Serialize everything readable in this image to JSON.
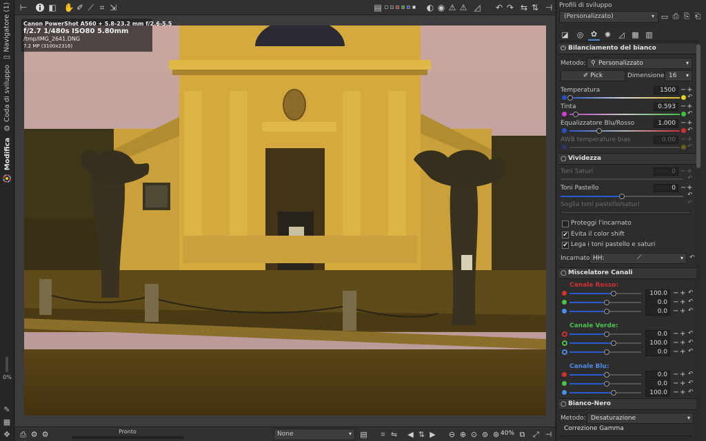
{
  "left_tabs": {
    "navigator": "Navigatore (1)",
    "queue": "Coda di sviluppo",
    "edit": "Modifica",
    "zoom_percent": "0%"
  },
  "image": {
    "exif_line1": "Canon PowerShot A560 + 5.8-23.2 mm f/2.6-5.5",
    "exif_line2": "f/2.7 1/480s ISO80 5.80mm",
    "exif_line3": "/tmp/IMG_2641.DNG",
    "exif_line4": "7.2 MP (3100x2316)"
  },
  "bottom": {
    "status": "Pronto",
    "preview_mode": "None",
    "zoom": "40%"
  },
  "right": {
    "profiles_title": "Profili di sviluppo",
    "profile_selected": "(Personalizzato)",
    "wb": {
      "title": "Bilanciamento del bianco",
      "method_label": "Metodo:",
      "method_value": "Personalizzato",
      "pick_label": "Pick",
      "size_label": "Dimensione:",
      "size_value": "16",
      "temp_label": "Temperatura",
      "temp_value": "1500",
      "tint_label": "Tinta",
      "tint_value": "0.593",
      "eq_label": "Equalizzatore Blu/Rosso",
      "eq_value": "1.000",
      "awb_label": "AWB temperature bias",
      "awb_value": "0.00"
    },
    "vibrance": {
      "title": "Vividezza",
      "saturated_label": "Toni Saturi",
      "saturated_value": "0",
      "pastel_label": "Toni Pastello",
      "pastel_value": "0",
      "threshold_label": "Soglia toni pastello/saturi",
      "protect_skin": "Proteggi l'incarnato",
      "avoid_shift": "Evita il color shift",
      "link_tones": "Lega i toni pastello e saturi",
      "skin_label": "Incarnato:",
      "skin_value": "HH:"
    },
    "mixer": {
      "title": "Miscelatore Canali",
      "red_channel": "Canale Rosso:",
      "green_channel": "Canale Verde:",
      "blue_channel": "Canale Blu:",
      "red": [
        "100.0",
        "0.0",
        "0.0"
      ],
      "green": [
        "0.0",
        "100.0",
        "0.0"
      ],
      "blue": [
        "0.0",
        "0.0",
        "100.0"
      ]
    },
    "bw": {
      "title": "Bianco-Nero",
      "method_label": "Metodo:",
      "method_value": "Desaturazione",
      "gamma_label": "Correzione Gamma"
    }
  },
  "colors": {
    "accent": "#4b8fd6",
    "red": "#d23232",
    "green": "#4cc14c",
    "blue": "#4d8ce8",
    "yellow": "#e8d020",
    "magenta": "#d040d0"
  },
  "icons": {
    "toolbar": [
      "history-icon",
      "info-icon",
      "before-after-icon",
      "hand-icon",
      "wb-picker-icon",
      "straighten-icon",
      "crop-icon",
      "resize-icon",
      "histogram-icon",
      "clipping-icons",
      "focus-mask-icon",
      "shadow-clip-icon",
      "highlight-clip-icon",
      "warning-icon",
      "rotate-left-icon",
      "rotate-right-icon",
      "flip-h-icon",
      "flip-v-icon",
      "panel-toggle-icon"
    ],
    "bottom": [
      "save-icon",
      "queue-icon",
      "editor-icon",
      "previous-icon",
      "sync-icon",
      "next-icon",
      "zoom-out-icon",
      "zoom-in-icon",
      "zoom-fit-icon",
      "zoom-100-icon",
      "fullscreen-icon",
      "panel-toggle-icon"
    ]
  }
}
